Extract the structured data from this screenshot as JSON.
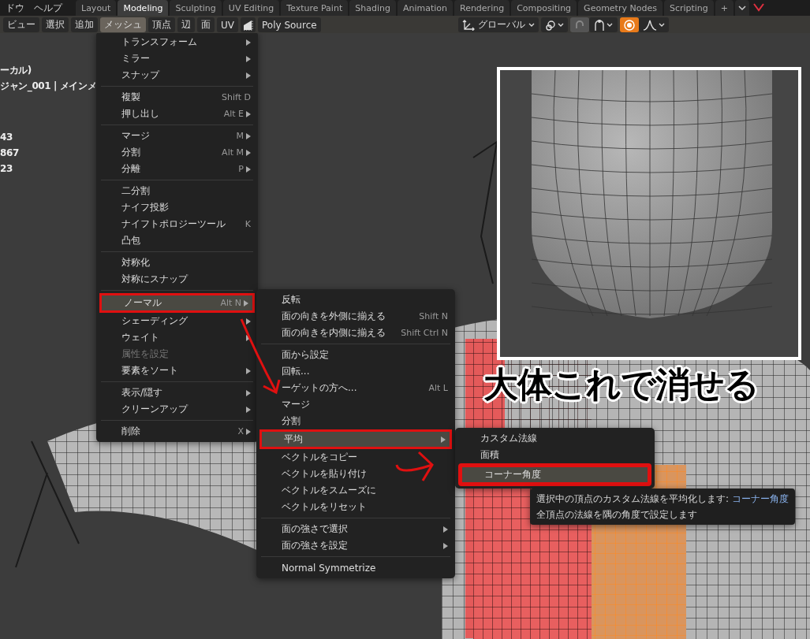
{
  "top_bar": {
    "menus": [
      "ドウ",
      "ヘルプ"
    ],
    "workspace_tabs": [
      {
        "label": "Layout",
        "selected": false
      },
      {
        "label": "Modeling",
        "selected": true
      },
      {
        "label": "Sculpting",
        "selected": false
      },
      {
        "label": "UV Editing",
        "selected": false
      },
      {
        "label": "Texture Paint",
        "selected": false
      },
      {
        "label": "Shading",
        "selected": false
      },
      {
        "label": "Animation",
        "selected": false
      },
      {
        "label": "Rendering",
        "selected": false
      },
      {
        "label": "Compositing",
        "selected": false
      },
      {
        "label": "Geometry Nodes",
        "selected": false
      },
      {
        "label": "Scripting",
        "selected": false
      }
    ],
    "add_tab": "+"
  },
  "viewport_header": {
    "menus": [
      {
        "label": "ビュー",
        "selected": false
      },
      {
        "label": "選択",
        "selected": false
      },
      {
        "label": "追加",
        "selected": false
      },
      {
        "label": "メッシュ",
        "selected": true
      },
      {
        "label": "頂点",
        "selected": false
      },
      {
        "label": "辺",
        "selected": false
      },
      {
        "label": "面",
        "selected": false
      },
      {
        "label": "UV",
        "selected": false
      }
    ],
    "poly_source": "Poly Source",
    "transform_orientation": "グローバル",
    "proportional_editing": {
      "on": true
    }
  },
  "viewport_overlay": [
    "ーカル)",
    "ジャン_001 | メインメ",
    "43",
    "867",
    "23"
  ],
  "menus": [
    {
      "items": [
        {
          "kind": "item",
          "label": "トランスフォーム",
          "submenu": true,
          "disabled": false,
          "selected": false,
          "annotated": false
        },
        {
          "kind": "item",
          "label": "ミラー",
          "submenu": true,
          "disabled": false,
          "selected": false,
          "annotated": false
        },
        {
          "kind": "item",
          "label": "スナップ",
          "submenu": true,
          "disabled": false,
          "selected": false,
          "annotated": false
        },
        {
          "kind": "separator"
        },
        {
          "kind": "item",
          "label": "複製",
          "shortcut": "Shift D",
          "submenu": false,
          "disabled": false,
          "selected": false,
          "annotated": false
        },
        {
          "kind": "item",
          "label": "押し出し",
          "shortcut": "Alt E",
          "submenu": true,
          "disabled": false,
          "selected": false,
          "annotated": false
        },
        {
          "kind": "separator"
        },
        {
          "kind": "item",
          "label": "マージ",
          "shortcut": "M",
          "submenu": true,
          "disabled": false,
          "selected": false,
          "annotated": false
        },
        {
          "kind": "item",
          "label": "分割",
          "shortcut": "Alt M",
          "submenu": true,
          "disabled": false,
          "selected": false,
          "annotated": false
        },
        {
          "kind": "item",
          "label": "分離",
          "shortcut": "P",
          "submenu": true,
          "disabled": false,
          "selected": false,
          "annotated": false
        },
        {
          "kind": "separator"
        },
        {
          "kind": "item",
          "label": "二分割",
          "submenu": false,
          "disabled": false,
          "selected": false,
          "annotated": false
        },
        {
          "kind": "item",
          "label": "ナイフ投影",
          "submenu": false,
          "disabled": false,
          "selected": false,
          "annotated": false
        },
        {
          "kind": "item",
          "label": "ナイフトポロジーツール",
          "shortcut": "K",
          "submenu": false,
          "disabled": false,
          "selected": false,
          "annotated": false
        },
        {
          "kind": "item",
          "label": "凸包",
          "submenu": false,
          "disabled": false,
          "selected": false,
          "annotated": false
        },
        {
          "kind": "separator"
        },
        {
          "kind": "item",
          "label": "対称化",
          "submenu": false,
          "disabled": false,
          "selected": false,
          "annotated": false
        },
        {
          "kind": "item",
          "label": "対称にスナップ",
          "submenu": false,
          "disabled": false,
          "selected": false,
          "annotated": false
        },
        {
          "kind": "separator"
        },
        {
          "kind": "item",
          "label": "ノーマル",
          "shortcut": "Alt N",
          "submenu": true,
          "disabled": false,
          "selected": true,
          "annotated": true
        },
        {
          "kind": "item",
          "label": "シェーディング",
          "submenu": true,
          "disabled": false,
          "selected": false,
          "annotated": false
        },
        {
          "kind": "item",
          "label": "ウェイト",
          "submenu": true,
          "disabled": false,
          "selected": false,
          "annotated": false
        },
        {
          "kind": "item",
          "label": "属性を設定",
          "submenu": false,
          "disabled": true,
          "selected": false,
          "annotated": false
        },
        {
          "kind": "item",
          "label": "要素をソート",
          "submenu": true,
          "disabled": false,
          "selected": false,
          "annotated": false
        },
        {
          "kind": "separator"
        },
        {
          "kind": "item",
          "label": "表示/隠す",
          "submenu": true,
          "disabled": false,
          "selected": false,
          "annotated": false
        },
        {
          "kind": "item",
          "label": "クリーンアップ",
          "submenu": true,
          "disabled": false,
          "selected": false,
          "annotated": false
        },
        {
          "kind": "separator"
        },
        {
          "kind": "item",
          "label": "削除",
          "shortcut": "X",
          "submenu": true,
          "disabled": false,
          "selected": false,
          "annotated": false
        }
      ]
    },
    {
      "items": [
        {
          "kind": "item",
          "label": "反転",
          "submenu": false,
          "disabled": false,
          "selected": false,
          "annotated": false
        },
        {
          "kind": "item",
          "label": "面の向きを外側に揃える",
          "shortcut": "Shift N",
          "submenu": false,
          "disabled": false,
          "selected": false,
          "annotated": false
        },
        {
          "kind": "item",
          "label": "面の向きを内側に揃える",
          "shortcut": "Shift Ctrl N",
          "submenu": false,
          "disabled": false,
          "selected": false,
          "annotated": false
        },
        {
          "kind": "separator"
        },
        {
          "kind": "item",
          "label": "面から設定",
          "submenu": false,
          "disabled": false,
          "selected": false,
          "annotated": false
        },
        {
          "kind": "item",
          "label": "回転...",
          "submenu": false,
          "disabled": false,
          "selected": false,
          "annotated": false
        },
        {
          "kind": "item",
          "label": "ーゲットの方へ...",
          "shortcut": "Alt L",
          "submenu": false,
          "disabled": false,
          "selected": false,
          "annotated": false
        },
        {
          "kind": "item",
          "label": "マージ",
          "submenu": false,
          "disabled": false,
          "selected": false,
          "annotated": false
        },
        {
          "kind": "item",
          "label": "分割",
          "submenu": false,
          "disabled": false,
          "selected": false,
          "annotated": false
        },
        {
          "kind": "item",
          "label": "平均",
          "submenu": true,
          "disabled": false,
          "selected": true,
          "annotated": true
        },
        {
          "kind": "item",
          "label": "ベクトルをコピー",
          "submenu": false,
          "disabled": false,
          "selected": false,
          "annotated": false
        },
        {
          "kind": "item",
          "label": "ベクトルを貼り付け",
          "submenu": false,
          "disabled": false,
          "selected": false,
          "annotated": false
        },
        {
          "kind": "item",
          "label": "ベクトルをスムーズに",
          "submenu": false,
          "disabled": false,
          "selected": false,
          "annotated": false
        },
        {
          "kind": "item",
          "label": "ベクトルをリセット",
          "submenu": false,
          "disabled": false,
          "selected": false,
          "annotated": false
        },
        {
          "kind": "separator"
        },
        {
          "kind": "item",
          "label": "面の強さで選択",
          "submenu": true,
          "disabled": false,
          "selected": false,
          "annotated": false
        },
        {
          "kind": "item",
          "label": "面の強さを設定",
          "submenu": true,
          "disabled": false,
          "selected": false,
          "annotated": false
        },
        {
          "kind": "separator"
        },
        {
          "kind": "item",
          "label": "Normal Symmetrize",
          "submenu": false,
          "disabled": false,
          "selected": false,
          "annotated": false
        }
      ]
    },
    {
      "items": [
        {
          "kind": "item",
          "label": "カスタム法線",
          "submenu": false,
          "disabled": false,
          "selected": false,
          "annotated": false
        },
        {
          "kind": "item",
          "label": "面積",
          "submenu": false,
          "disabled": false,
          "selected": false,
          "annotated": false
        },
        {
          "kind": "item",
          "label": "コーナー角度",
          "submenu": false,
          "disabled": false,
          "selected": true,
          "annotated": true
        }
      ]
    }
  ],
  "tooltip": {
    "text": "選択中の頂点のカスタム法線を平均化します: ",
    "highlight": "コーナー角度",
    "description": "全頂点の法線を隅の角度で設定します"
  },
  "caption": "大体これで消せる"
}
